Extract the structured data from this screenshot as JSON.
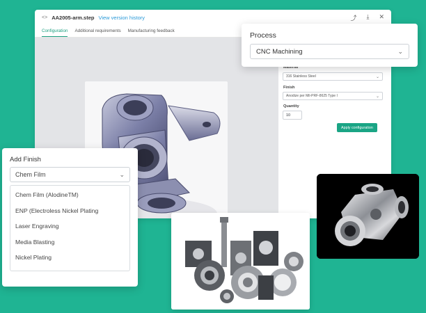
{
  "window": {
    "file_name": "AA2005-arm.step",
    "version_link": "View version history"
  },
  "tabs": [
    {
      "label": "Configuration",
      "active": true
    },
    {
      "label": "Additional requirements",
      "active": false
    },
    {
      "label": "Manufacturing feedback",
      "active": false
    }
  ],
  "config": {
    "material_label": "Material",
    "material_value": "316 Stainless Steel",
    "finish_label": "Finish",
    "finish_value": "Anodize per Mil-PRF-8625 Type I",
    "quantity_label": "Quantity",
    "quantity_value": "10",
    "apply_label": "Apply configuration"
  },
  "process": {
    "label": "Process",
    "value": "CNC Machining"
  },
  "finish": {
    "label": "Add Finish",
    "value": "Chem Film",
    "options": [
      "Chem Film (AlodineTM)",
      "ENP (Electroless Nickel Plating",
      "Laser Engraving",
      "Media Blasting",
      "Nickel Plating"
    ]
  },
  "colors": {
    "background": "#1fb493",
    "accent": "#1aa585",
    "link": "#2b9ad8"
  },
  "icons": [
    "code-icon",
    "share-icon",
    "download-icon",
    "close-icon",
    "chevron-down-icon"
  ]
}
